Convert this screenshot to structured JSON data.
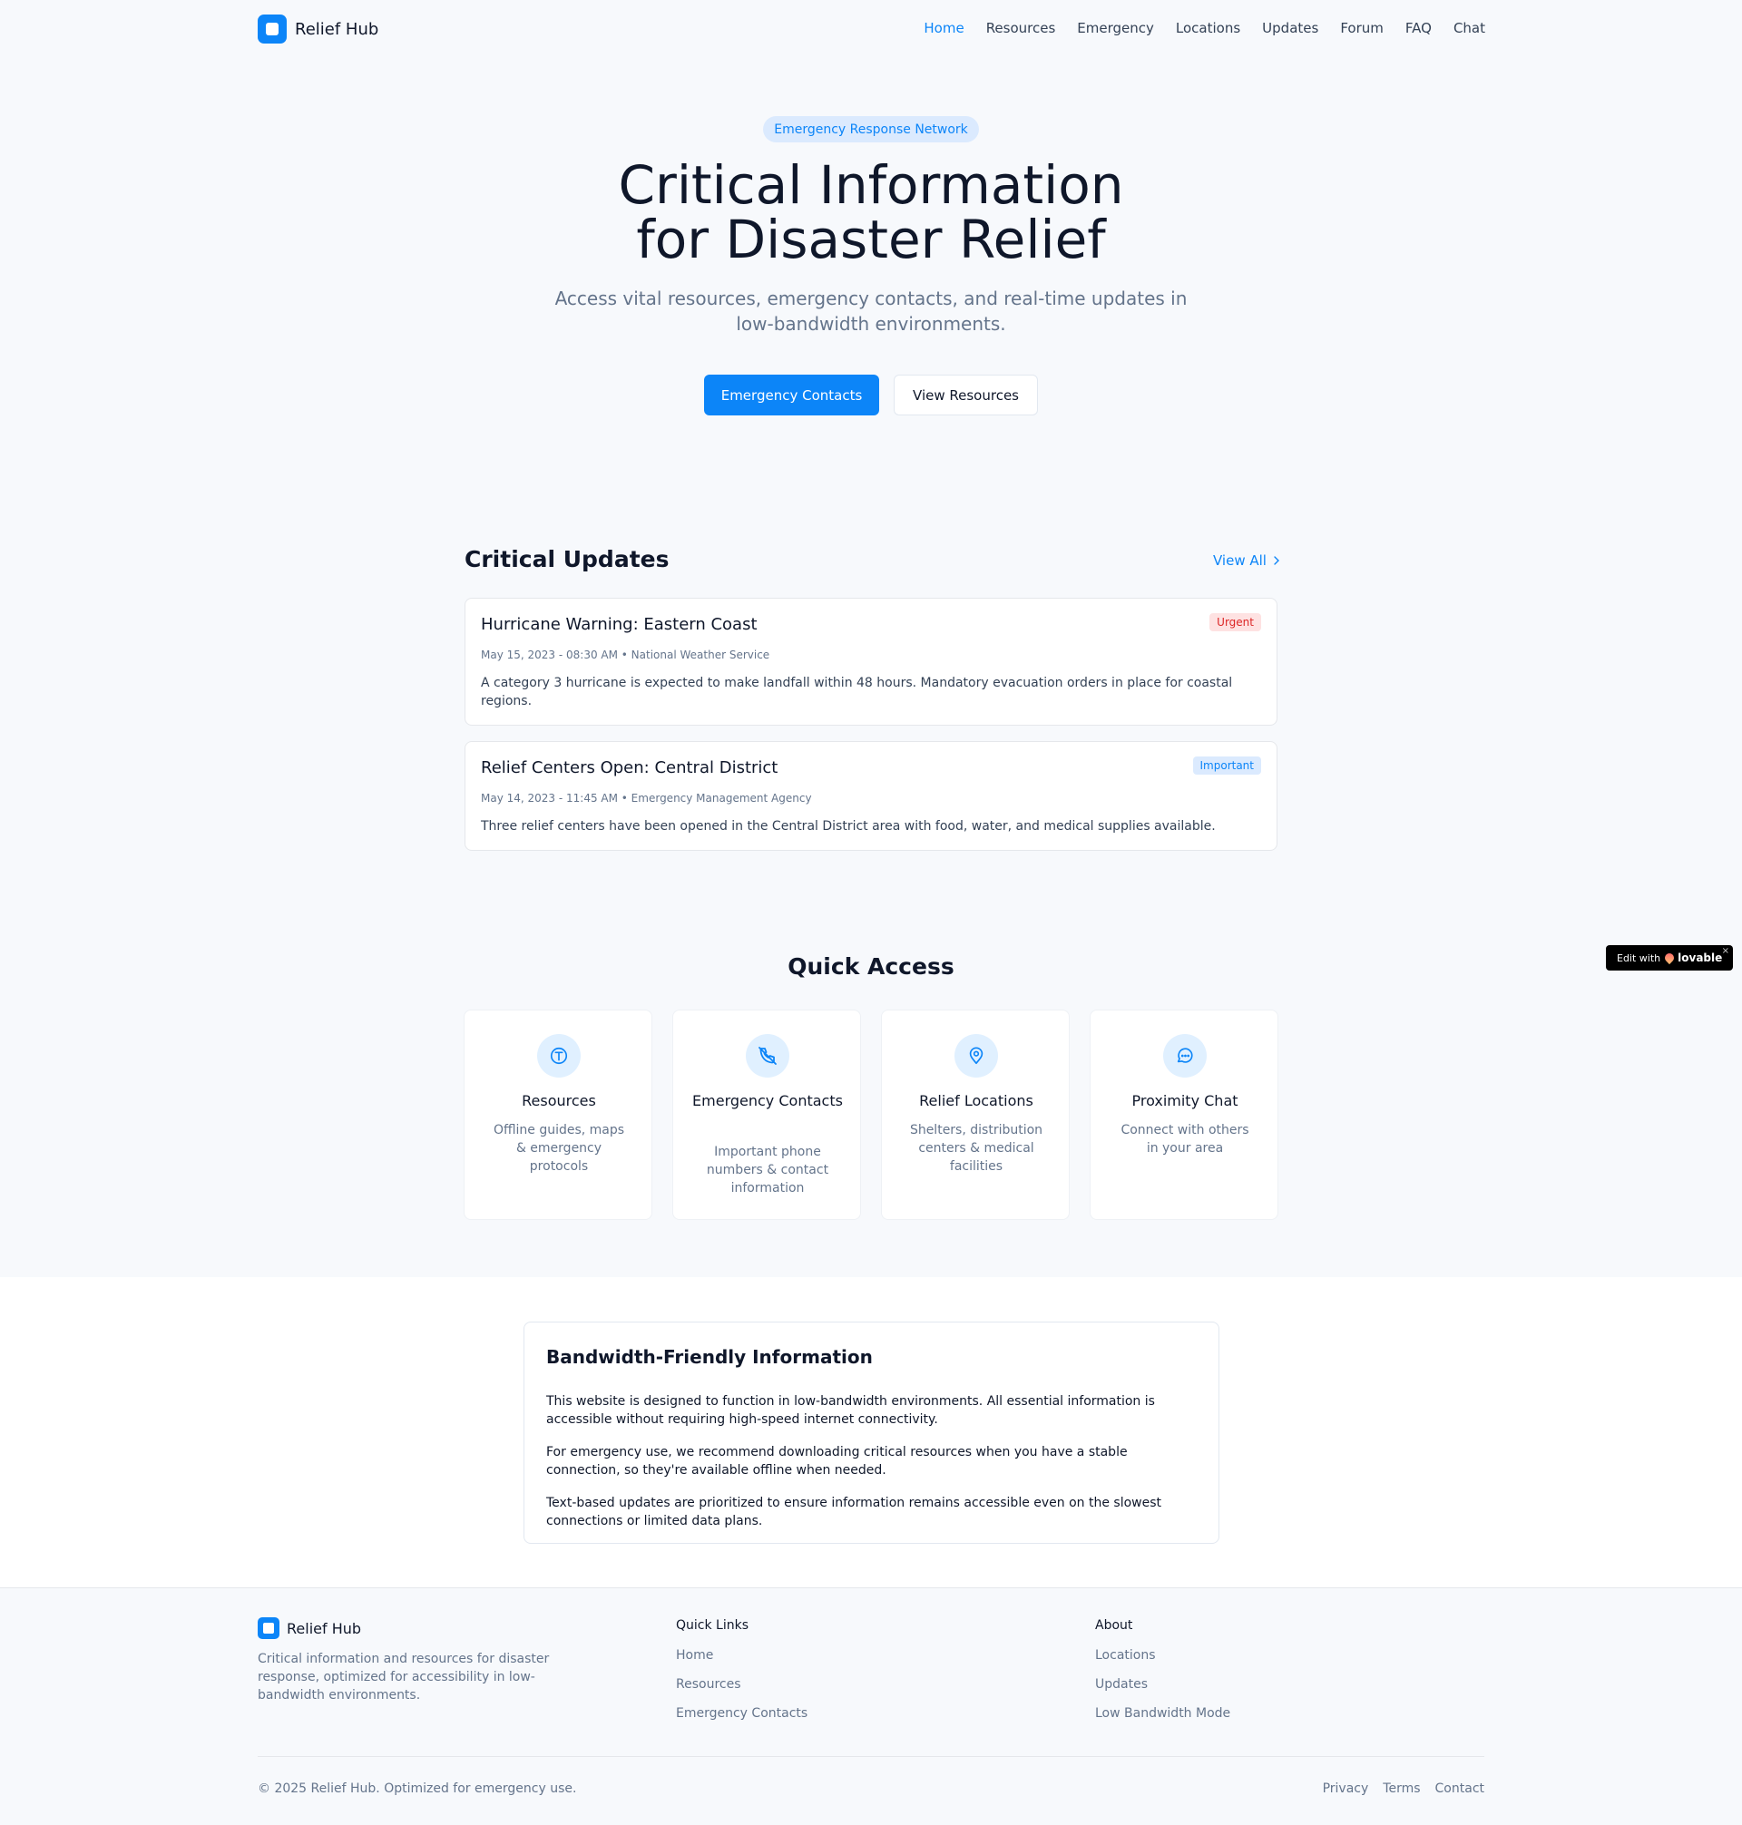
{
  "header": {
    "brand": "Relief Hub",
    "nav": [
      "Home",
      "Resources",
      "Emergency",
      "Locations",
      "Updates",
      "Forum",
      "FAQ",
      "Chat"
    ]
  },
  "hero": {
    "badge": "Emergency Response Network",
    "title_line1": "Critical Information",
    "title_line2": "for Disaster Relief",
    "subtitle": "Access vital resources, emergency contacts, and real-time updates in low-bandwidth environments.",
    "primary_cta": "Emergency Contacts",
    "secondary_cta": "View Resources"
  },
  "updates": {
    "title": "Critical Updates",
    "view_all": "View All",
    "items": [
      {
        "title": "Hurricane Warning: Eastern Coast",
        "meta": "May 15, 2023 - 08:30 AM • National Weather Service",
        "body": "A category 3 hurricane is expected to make landfall within 48 hours. Mandatory evacuation orders in place for coastal regions.",
        "tag": "Urgent"
      },
      {
        "title": "Relief Centers Open: Central District",
        "meta": "May 14, 2023 - 11:45 AM • Emergency Management Agency",
        "body": "Three relief centers have been opened in the Central District area with food, water, and medical supplies available.",
        "tag": "Important"
      }
    ]
  },
  "quick_access": {
    "title": "Quick Access",
    "cards": [
      {
        "title": "Resources",
        "desc": "Offline guides, maps & emergency protocols",
        "icon": "info-book-icon"
      },
      {
        "title": "Emergency Contacts",
        "desc": "Important phone numbers & contact information",
        "icon": "phone-off-icon"
      },
      {
        "title": "Relief Locations",
        "desc": "Shelters, distribution centers & medical facilities",
        "icon": "map-pin-icon"
      },
      {
        "title": "Proximity Chat",
        "desc": "Connect with others in your area",
        "icon": "chat-bubble-icon"
      }
    ]
  },
  "bandwidth": {
    "title": "Bandwidth-Friendly Information",
    "p1": "This website is designed to function in low-bandwidth environments. All essential information is accessible without requiring high-speed internet connectivity.",
    "p2": "For emergency use, we recommend downloading critical resources when you have a stable connection, so they're available offline when needed.",
    "p3": "Text-based updates are prioritized to ensure information remains accessible even on the slowest connections or limited data plans."
  },
  "footer": {
    "brand": "Relief Hub",
    "desc": "Critical information and resources for disaster response, optimized for accessibility in low-bandwidth environments.",
    "quick_links_title": "Quick Links",
    "quick_links": [
      "Home",
      "Resources",
      "Emergency Contacts"
    ],
    "about_title": "About",
    "about_links": [
      "Locations",
      "Updates",
      "Low Bandwidth Mode"
    ],
    "copyright": "© 2025 Relief Hub. Optimized for emergency use.",
    "legal": [
      "Privacy",
      "Terms",
      "Contact"
    ]
  },
  "lovable": {
    "prefix": "Edit with",
    "brand": "lovable",
    "close": "×"
  },
  "colors": {
    "accent": "#0c85f8",
    "urgent": "#dc2626",
    "background": "#f7f9fc"
  }
}
